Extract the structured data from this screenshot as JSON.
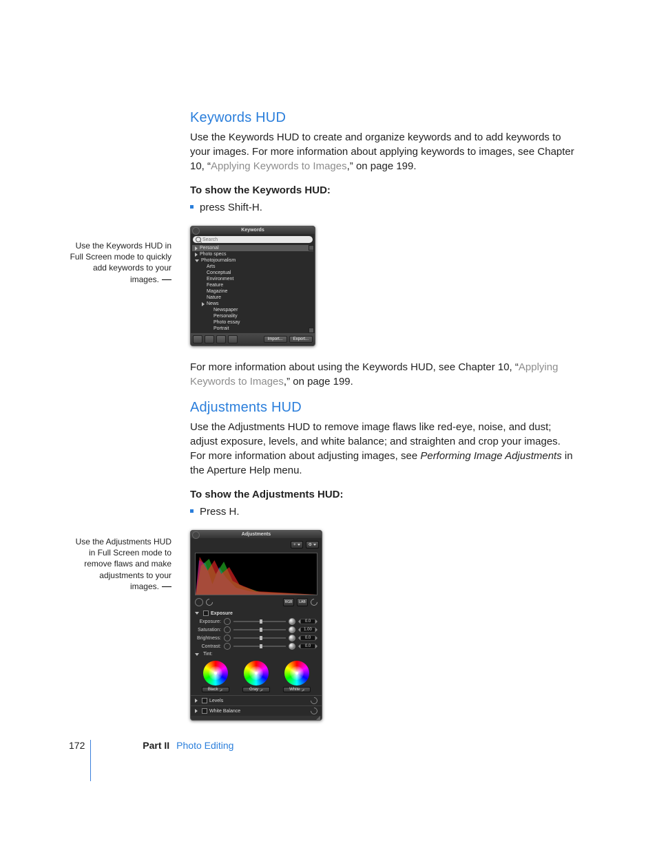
{
  "sections": {
    "keywords": {
      "heading": "Keywords HUD",
      "intro_a": "Use the Keywords HUD to create and organize keywords and to add keywords to your images. For more information about applying keywords to images, see Chapter 10, “",
      "intro_link": "Applying Keywords to Images",
      "intro_b": ",” on page 199.",
      "toshow": "To show the Keywords HUD:",
      "bullet": "press Shift-H.",
      "after_a": "For more information about using the Keywords HUD, see Chapter 10, “",
      "after_link": "Applying Keywords to Images",
      "after_b": ",” on page 199.",
      "caption": "Use the Keywords HUD in Full Screen mode to quickly add keywords to your images."
    },
    "adjustments": {
      "heading": "Adjustments HUD",
      "intro": "Use the Adjustments HUD to remove image flaws like red-eye, noise, and dust; adjust exposure, levels, and white balance; and straighten and crop your images. For more information about adjusting images, see ",
      "intro_em": "Performing Image Adjustments",
      "intro_tail": " in the Aperture Help menu.",
      "toshow": "To show the Adjustments HUD:",
      "bullet": "Press H.",
      "caption": "Use the Adjustments HUD in Full Screen mode to remove flaws and make adjustments to your images."
    }
  },
  "hud_keywords": {
    "title": "Keywords",
    "search_placeholder": "Search",
    "items": [
      {
        "label": "Personal",
        "indent": 0,
        "disc": "closed",
        "sel": true
      },
      {
        "label": "Photo specs",
        "indent": 0,
        "disc": "closed",
        "sel": false
      },
      {
        "label": "Photojournalism",
        "indent": 0,
        "disc": "open",
        "sel": false
      },
      {
        "label": "Arts",
        "indent": 1,
        "sel": false
      },
      {
        "label": "Conceptual",
        "indent": 1,
        "sel": false
      },
      {
        "label": "Environment",
        "indent": 1,
        "sel": false
      },
      {
        "label": "Feature",
        "indent": 1,
        "sel": false
      },
      {
        "label": "Magazine",
        "indent": 1,
        "sel": false
      },
      {
        "label": "Nature",
        "indent": 1,
        "sel": false
      },
      {
        "label": "News",
        "indent": 1,
        "disc": "closed",
        "sel": false
      },
      {
        "label": "Newspaper",
        "indent": 2,
        "sel": false
      },
      {
        "label": "Personality",
        "indent": 2,
        "sel": false
      },
      {
        "label": "Photo essay",
        "indent": 2,
        "sel": false
      },
      {
        "label": "Portrait",
        "indent": 2,
        "sel": false
      }
    ],
    "import": "Import...",
    "export": "Export..."
  },
  "hud_adjustments": {
    "title": "Adjustments",
    "dropdown_plus": "+",
    "dropdown_gear": "⚙",
    "exposure_head": "Exposure",
    "sliders": [
      {
        "label": "Exposure:",
        "value": "0.0",
        "knob": 50
      },
      {
        "label": "Saturation:",
        "value": "1.00",
        "knob": 50
      },
      {
        "label": "Brightness:",
        "value": "0.0",
        "knob": 50
      },
      {
        "label": "Contrast:",
        "value": "0.0",
        "knob": 50
      }
    ],
    "tint_head": "Tint:",
    "wheel_labels": [
      "Black",
      "Gray",
      "White"
    ],
    "collapsed": [
      "Levels",
      "White Balance"
    ]
  },
  "footer": {
    "page": "172",
    "part_label": "Part II",
    "chapter": "Photo Editing"
  }
}
